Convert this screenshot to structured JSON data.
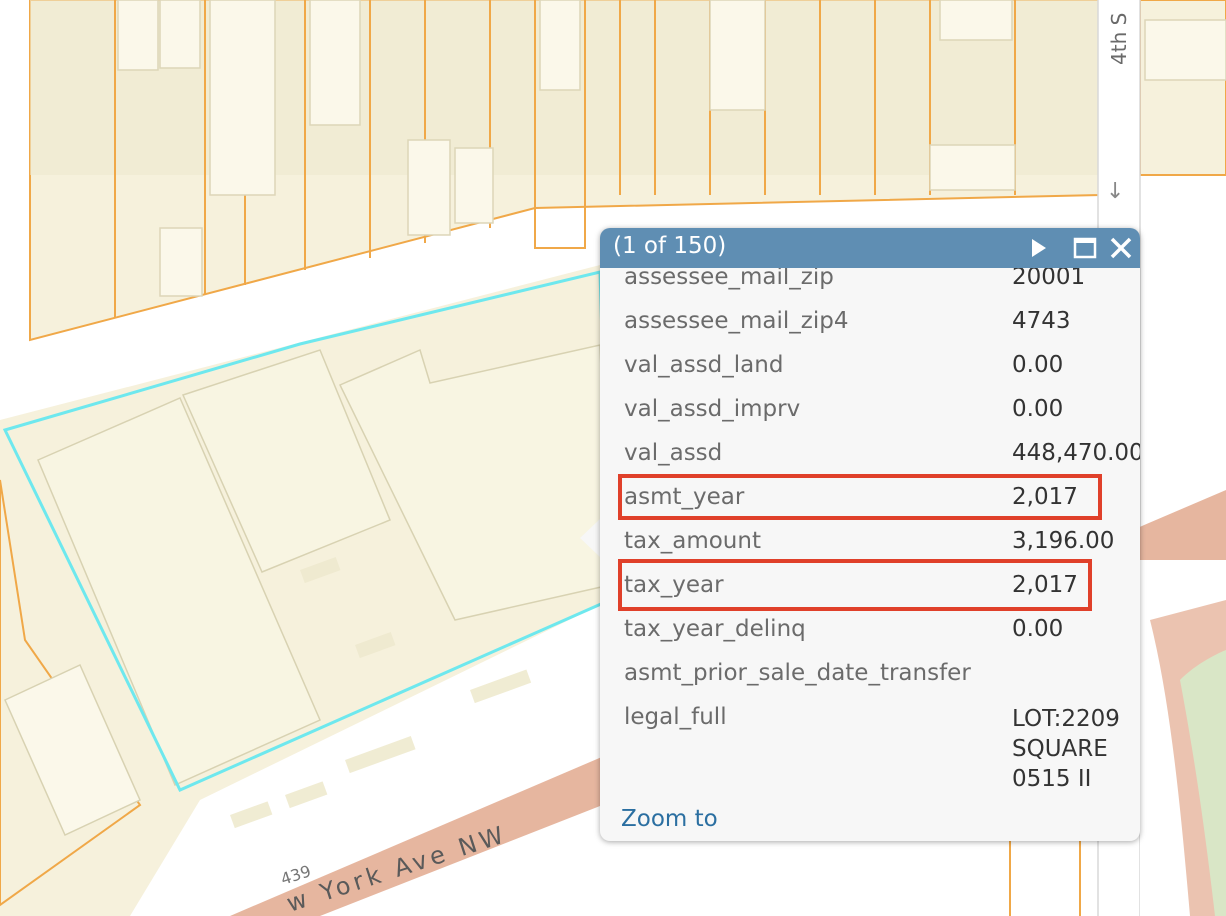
{
  "map": {
    "street_label": "w York Ave NW",
    "street_label_4th": "4th S",
    "lot_number": "439",
    "one_way_arrow": "↓"
  },
  "popup": {
    "title": "(1 of 150)",
    "next_icon": "play-icon",
    "maximize_icon": "maximize-icon",
    "close_icon": "close-icon",
    "rows": [
      {
        "key": "assessee_mail_zip",
        "value": "20001"
      },
      {
        "key": "assessee_mail_zip4",
        "value": "4743"
      },
      {
        "key": "val_assd_land",
        "value": "0.00"
      },
      {
        "key": "val_assd_imprv",
        "value": "0.00"
      },
      {
        "key": "val_assd",
        "value": "448,470.00"
      },
      {
        "key": "asmt_year",
        "value": "2,017"
      },
      {
        "key": "tax_amount",
        "value": "3,196.00"
      },
      {
        "key": "tax_year",
        "value": "2,017"
      },
      {
        "key": "tax_year_delinq",
        "value": "0.00"
      },
      {
        "key": "asmt_prior_sale_date_transfer",
        "value": ""
      },
      {
        "key": "legal_full",
        "value": "LOT:2209 SQUARE 0515 II"
      }
    ],
    "zoom_link": "Zoom to"
  },
  "colors": {
    "header": "#5f8eb3",
    "highlight": "#e0402a",
    "parcel_line": "#f0a848",
    "selection": "#6ee8ee",
    "road": "#e2a98e"
  }
}
